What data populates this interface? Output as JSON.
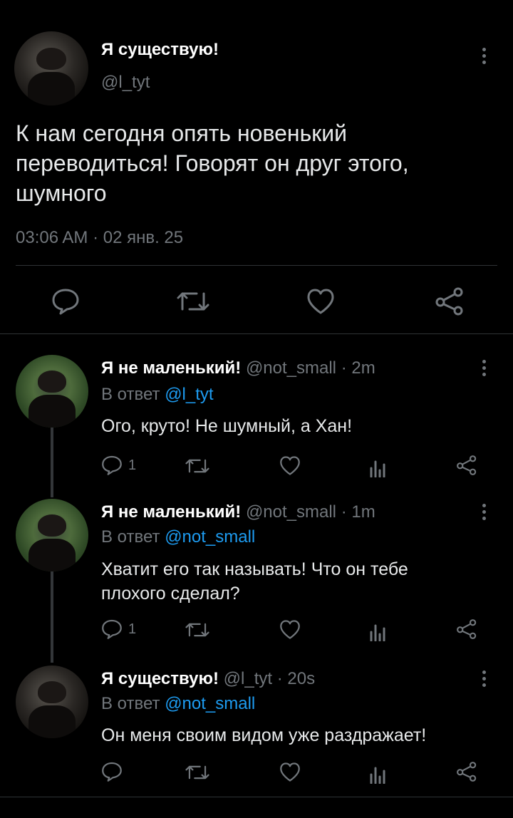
{
  "main_tweet": {
    "display_name": "Я существую!",
    "handle": "@l_tyt",
    "text": "К нам сегодня опять новенький переводиться! Говорят он друг этого, шумного",
    "timestamp": "03:06 AM · 02 янв. 25"
  },
  "replies": [
    {
      "display_name": "Я не маленький!",
      "handle": "@not_small",
      "time": "· 2m",
      "reply_prefix": "В ответ",
      "reply_to": "@l_tyt",
      "text": "Ого, круто! Не шумный, а Хан!",
      "reply_count": "1"
    },
    {
      "display_name": "Я не маленький!",
      "handle": "@not_small",
      "time": "· 1m",
      "reply_prefix": "В ответ",
      "reply_to": "@not_small",
      "text": "Хватит его так называть! Что он тебе плохого сделал?",
      "reply_count": "1"
    },
    {
      "display_name": "Я существую!",
      "handle": "@l_tyt",
      "time": "· 20s",
      "reply_prefix": "В ответ",
      "reply_to": "@not_small",
      "text": "Он меня своим видом уже раздражает!",
      "reply_count": ""
    }
  ],
  "colors": {
    "background": "#000000",
    "muted": "#71767b",
    "link": "#1d9bf0",
    "divider": "#2f3336"
  },
  "icons": [
    "reply-icon",
    "retweet-icon",
    "like-icon",
    "views-icon",
    "share-icon",
    "more-icon"
  ]
}
